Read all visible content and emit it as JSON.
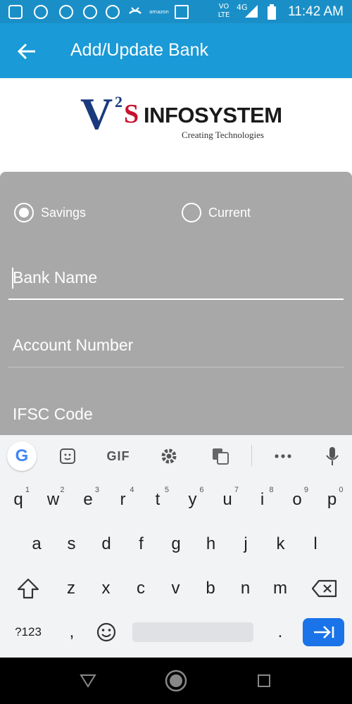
{
  "status_bar": {
    "time": "11:42 AM",
    "network_label": "4G",
    "volte_label": "VO LTE",
    "amazon_label": "amazon",
    "icons": [
      "sim-icon",
      "chat-icon",
      "rupee-icon",
      "headset-icon",
      "swirl-icon",
      "missed-call-icon",
      "amazon-icon",
      "image-icon",
      "volte-icon",
      "signal-icon",
      "battery-icon"
    ]
  },
  "appbar": {
    "title": "Add/Update Bank",
    "back_icon": "arrow-left-icon",
    "color": "#1a9ad6"
  },
  "logo": {
    "v_letter": "V",
    "sup": "2",
    "s_letter": "S",
    "name": "INFOSYSTEM",
    "tagline": "Creating Technologies"
  },
  "form": {
    "account_type": {
      "options": [
        {
          "label": "Savings",
          "selected": true
        },
        {
          "label": "Current",
          "selected": false
        }
      ]
    },
    "fields": {
      "bank_name": {
        "placeholder": "Bank Name",
        "value": ""
      },
      "account_number": {
        "placeholder": "Account Number",
        "value": ""
      },
      "ifsc_code": {
        "placeholder": "IFSC Code",
        "value": ""
      }
    },
    "card_color": "#a8a8a8"
  },
  "keyboard": {
    "toolbar": {
      "google": "G",
      "gif": "GIF",
      "icons": [
        "google-icon",
        "sticker-icon",
        "gif-icon",
        "settings-icon",
        "translate-icon",
        "more-icon",
        "mic-icon"
      ]
    },
    "row1": [
      {
        "k": "q",
        "s": "1"
      },
      {
        "k": "w",
        "s": "2"
      },
      {
        "k": "e",
        "s": "3"
      },
      {
        "k": "r",
        "s": "4"
      },
      {
        "k": "t",
        "s": "5"
      },
      {
        "k": "y",
        "s": "6"
      },
      {
        "k": "u",
        "s": "7"
      },
      {
        "k": "i",
        "s": "8"
      },
      {
        "k": "o",
        "s": "9"
      },
      {
        "k": "p",
        "s": "0"
      }
    ],
    "row2": [
      "a",
      "s",
      "d",
      "f",
      "g",
      "h",
      "j",
      "k",
      "l"
    ],
    "row3": [
      "z",
      "x",
      "c",
      "v",
      "b",
      "n",
      "m"
    ],
    "row4": {
      "symbols": "?123",
      "comma": ",",
      "period": "."
    },
    "enter_color": "#1a73e8"
  }
}
